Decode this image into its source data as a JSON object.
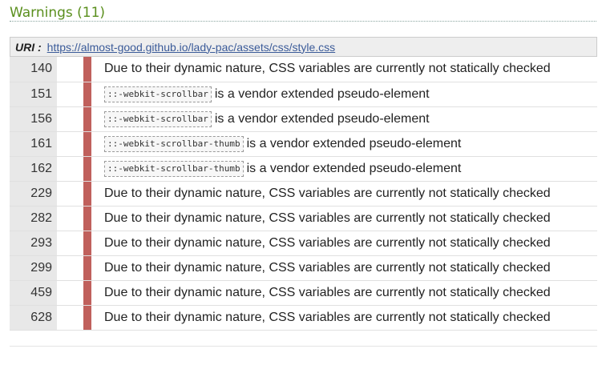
{
  "heading": "Warnings (11)",
  "uri": {
    "label": "URI :",
    "link": "https://almost-good.github.io/lady-pac/assets/css/style.css"
  },
  "rows": [
    {
      "line": "140",
      "code": "",
      "message": "Due to their dynamic nature, CSS variables are currently not statically checked"
    },
    {
      "line": "151",
      "code": "::-webkit-scrollbar",
      "message": "is a vendor extended pseudo-element"
    },
    {
      "line": "156",
      "code": "::-webkit-scrollbar",
      "message": "is a vendor extended pseudo-element"
    },
    {
      "line": "161",
      "code": "::-webkit-scrollbar-thumb",
      "message": "is a vendor extended pseudo-element"
    },
    {
      "line": "162",
      "code": "::-webkit-scrollbar-thumb",
      "message": "is a vendor extended pseudo-element"
    },
    {
      "line": "229",
      "code": "",
      "message": "Due to their dynamic nature, CSS variables are currently not statically checked"
    },
    {
      "line": "282",
      "code": "",
      "message": "Due to their dynamic nature, CSS variables are currently not statically checked"
    },
    {
      "line": "293",
      "code": "",
      "message": "Due to their dynamic nature, CSS variables are currently not statically checked"
    },
    {
      "line": "299",
      "code": "",
      "message": "Due to their dynamic nature, CSS variables are currently not statically checked"
    },
    {
      "line": "459",
      "code": "",
      "message": "Due to their dynamic nature, CSS variables are currently not statically checked"
    },
    {
      "line": "628",
      "code": "",
      "message": "Due to their dynamic nature, CSS variables are currently not statically checked"
    }
  ],
  "colors": {
    "heading": "#5a8f1d",
    "warning_bar": "#c0605c",
    "link": "#3b5b99"
  }
}
